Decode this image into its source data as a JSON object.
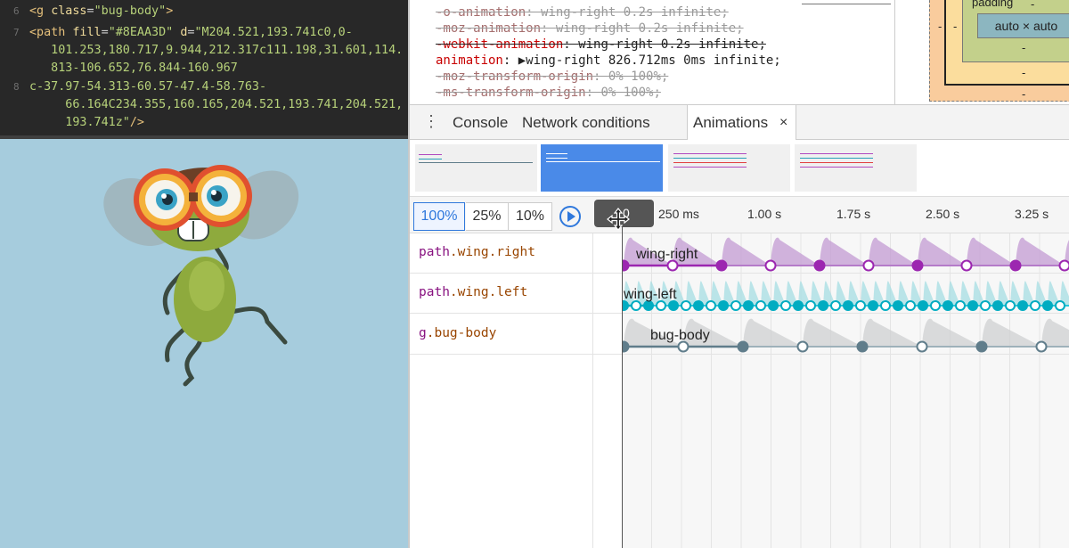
{
  "code": {
    "lines": [
      {
        "num": "6",
        "parts": [
          [
            "k-tag",
            "<g "
          ],
          [
            "k-attr",
            "class"
          ],
          [
            "k-pun",
            "="
          ],
          [
            "k-str",
            "\"bug-body\""
          ],
          [
            "k-tag",
            ">"
          ]
        ]
      },
      {
        "num": "7",
        "parts": [
          [
            "k-tag",
            "<path "
          ],
          [
            "k-attr",
            "fill"
          ],
          [
            "k-pun",
            "="
          ],
          [
            "k-str",
            "\"#8EAA3D\""
          ],
          [
            "k-pun",
            " "
          ],
          [
            "k-attr",
            "d"
          ],
          [
            "k-pun",
            "="
          ],
          [
            "k-str",
            "\"M204.521,193.741c0,0-"
          ]
        ]
      },
      {
        "num": "",
        "parts": [
          [
            "k-str",
            "   101.253,180.717,9.944,212.317c111.198,31.601,114."
          ]
        ]
      },
      {
        "num": "",
        "parts": [
          [
            "k-str",
            "   813-106.652,76.844-160.967"
          ]
        ]
      },
      {
        "num": "8",
        "parts": [
          [
            "k-str",
            "c-37.97-54.313-60.57-47.4-58.763-"
          ]
        ]
      },
      {
        "num": "",
        "parts": [
          [
            "k-str",
            "     66.164C234.355,160.165,204.521,193.741,204.521,"
          ]
        ]
      },
      {
        "num": "",
        "parts": [
          [
            "k-str",
            "     193.741z\""
          ],
          [
            "k-tag",
            "/>"
          ]
        ]
      }
    ]
  },
  "styles": {
    "rules": [
      {
        "prop": "-o-animation",
        "value": "wing-right 0.2s infinite;",
        "state": "struck"
      },
      {
        "prop": "-moz-animation",
        "value": "wing-right 0.2s infinite;",
        "state": "struck"
      },
      {
        "prop": "-webkit-animation",
        "value": "wing-right 0.2s infinite;",
        "state": "struck-red"
      },
      {
        "prop": "animation",
        "value": "▶wing-right 826.712ms 0ms infinite;",
        "state": "active"
      },
      {
        "prop": "-moz-transform-origin",
        "value": "0% 100%;",
        "state": "struck"
      },
      {
        "prop": "-ms-transform-origin",
        "value": "0% 100%;",
        "state": "struck"
      }
    ]
  },
  "box_model": {
    "padding_label": "padding",
    "content_size": "auto × auto",
    "dash": "-"
  },
  "drawer": {
    "menu_icon": "⋮",
    "tabs": {
      "console": "Console",
      "network": "Network conditions",
      "animations": "Animations",
      "close": "×"
    }
  },
  "toolbar": {
    "rates": [
      "100%",
      "25%",
      "10%"
    ],
    "ticks": [
      "250 ms",
      "1.00 s",
      "1.75 s",
      "2.50 s",
      "3.25 s"
    ],
    "scrubber_label": "0"
  },
  "timeline": {
    "rows": [
      {
        "el": "path",
        "cls": ".wing.right",
        "name": "wing-right",
        "color": "#9c27b0"
      },
      {
        "el": "path",
        "cls": ".wing.left",
        "name": "wing-left",
        "color": "#00bcd4"
      },
      {
        "el": "g",
        "cls": ".bug-body",
        "name": "bug-body",
        "color": "#607d8b"
      }
    ]
  },
  "colors": {
    "accent": "#4a8ae8",
    "wing_right": "#9c27b0",
    "wing_left": "#26c6da",
    "bug_body": "#607d8b",
    "preview_bg": "#a6ccdd"
  }
}
